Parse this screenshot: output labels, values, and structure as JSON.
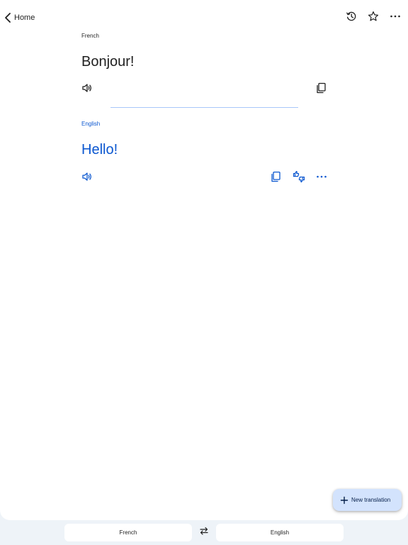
{
  "colors": {
    "accent": "#0b57d0",
    "text": "#1f1f1f",
    "background": "#eef3f8",
    "fab_background": "#d3e3fd"
  },
  "header": {
    "back_label": "Home",
    "icons": [
      "back-chevron-icon",
      "history-icon",
      "star-icon",
      "more-icon"
    ]
  },
  "source": {
    "language": "French",
    "text": "Bonjour!",
    "icons": [
      "speaker-icon",
      "copy-icon"
    ]
  },
  "target": {
    "language": "English",
    "text": "Hello!",
    "icons": [
      "speaker-icon",
      "copy-icon",
      "feedback-icon",
      "more-icon"
    ]
  },
  "fab": {
    "label": "New translation",
    "icon": "plus-icon"
  },
  "language_bar": {
    "source_language": "French",
    "target_language": "English",
    "swap_icon": "swap-icon"
  }
}
